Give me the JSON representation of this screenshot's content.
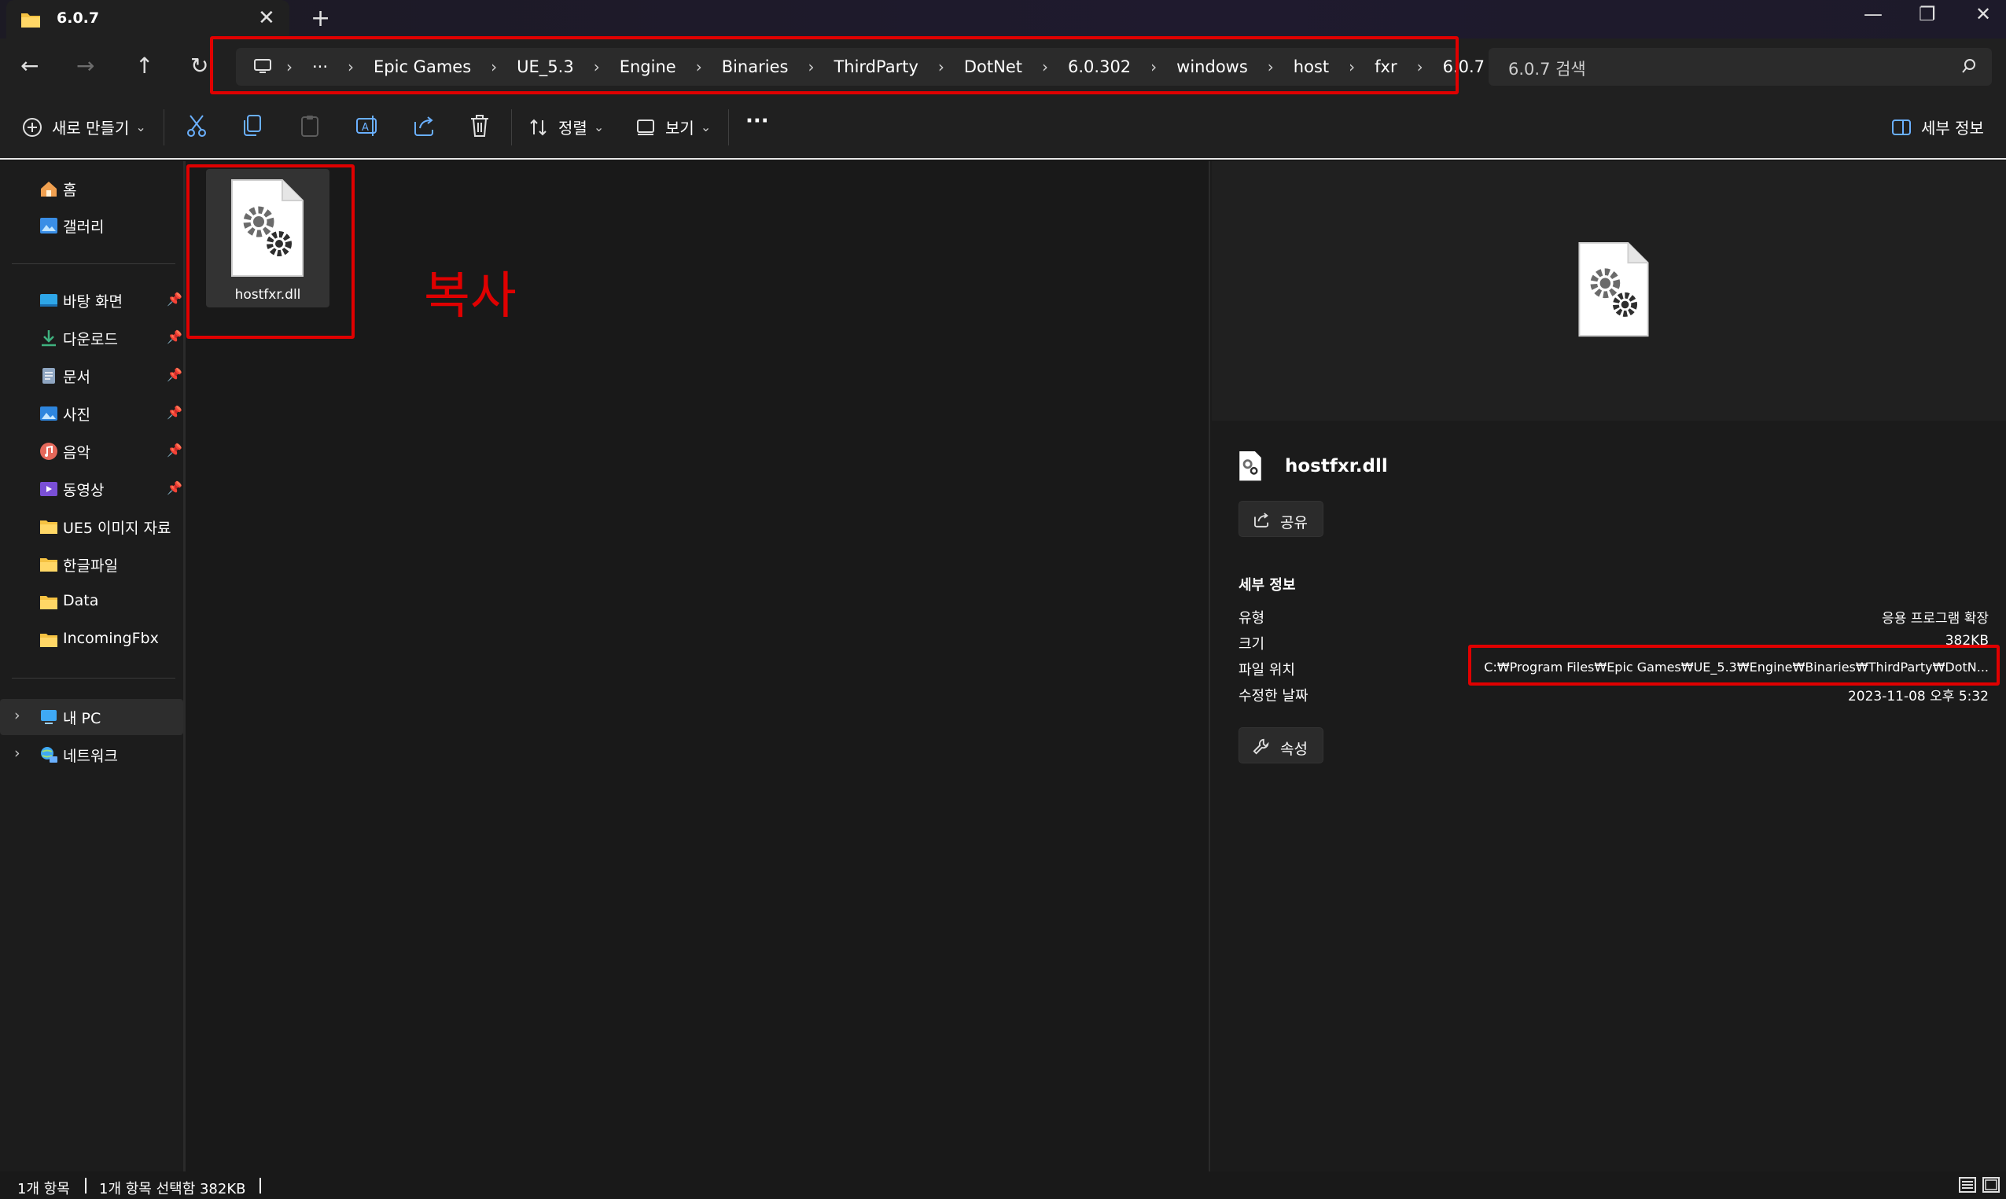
{
  "window": {
    "tab_title": "6.0.7",
    "new_tab_glyph": "+",
    "close_glyph": "✕",
    "minimize_glyph": "—",
    "maximize_glyph": "❐",
    "win_close_glyph": "✕"
  },
  "nav": {
    "back_glyph": "←",
    "forward_glyph": "→",
    "up_glyph": "↑",
    "refresh_glyph": "↻",
    "more_glyph": "···",
    "breadcrumbs": [
      "Epic Games",
      "UE_5.3",
      "Engine",
      "Binaries",
      "ThirdParty",
      "DotNet",
      "6.0.302",
      "windows",
      "host",
      "fxr",
      "6.0.7"
    ],
    "separator": "›",
    "search_placeholder": "6.0.7 검색"
  },
  "toolbar": {
    "new_label": "새로 만들기",
    "sort_label": "정렬",
    "view_label": "보기",
    "more_glyph": "···",
    "details_label": "세부 정보",
    "caret": "⌄"
  },
  "sidebar": {
    "items": [
      {
        "label": "홈",
        "icon": "home-icon"
      },
      {
        "label": "갤러리",
        "icon": "gallery-icon"
      },
      {
        "label": "바탕 화면",
        "icon": "desktop-icon",
        "pinned": true
      },
      {
        "label": "다운로드",
        "icon": "download-icon",
        "pinned": true
      },
      {
        "label": "문서",
        "icon": "document-icon",
        "pinned": true
      },
      {
        "label": "사진",
        "icon": "pictures-icon",
        "pinned": true
      },
      {
        "label": "음악",
        "icon": "music-icon",
        "pinned": true
      },
      {
        "label": "동영상",
        "icon": "video-icon",
        "pinned": true
      },
      {
        "label": "UE5 이미지 자료",
        "icon": "folder-icon"
      },
      {
        "label": "한글파일",
        "icon": "folder-icon"
      },
      {
        "label": "Data",
        "icon": "folder-icon"
      },
      {
        "label": "IncomingFbx",
        "icon": "folder-icon"
      },
      {
        "label": "내 PC",
        "icon": "pc-icon"
      },
      {
        "label": "네트워크",
        "icon": "network-icon"
      }
    ],
    "pin_glyph": "📌",
    "chevron": "›"
  },
  "content": {
    "file_name": "hostfxr.dll",
    "annotation": "복사"
  },
  "details": {
    "file_name": "hostfxr.dll",
    "share_label": "공유",
    "section_title": "세부 정보",
    "rows": [
      {
        "key": "유형",
        "value": "응용 프로그램 확장"
      },
      {
        "key": "크기",
        "value": "382KB"
      },
      {
        "key": "파일 위치",
        "value": "C:₩Program Files₩Epic Games₩UE_5.3₩Engine₩Binaries₩ThirdParty₩DotN..."
      },
      {
        "key": "수정한 날짜",
        "value": "2023-11-08 오후 5:32"
      }
    ],
    "properties_label": "속성"
  },
  "status": {
    "item_count": "1개 항목",
    "selection": "1개 항목 선택함 382KB"
  },
  "colors": {
    "highlight": "#e00000",
    "background": "#191919"
  }
}
